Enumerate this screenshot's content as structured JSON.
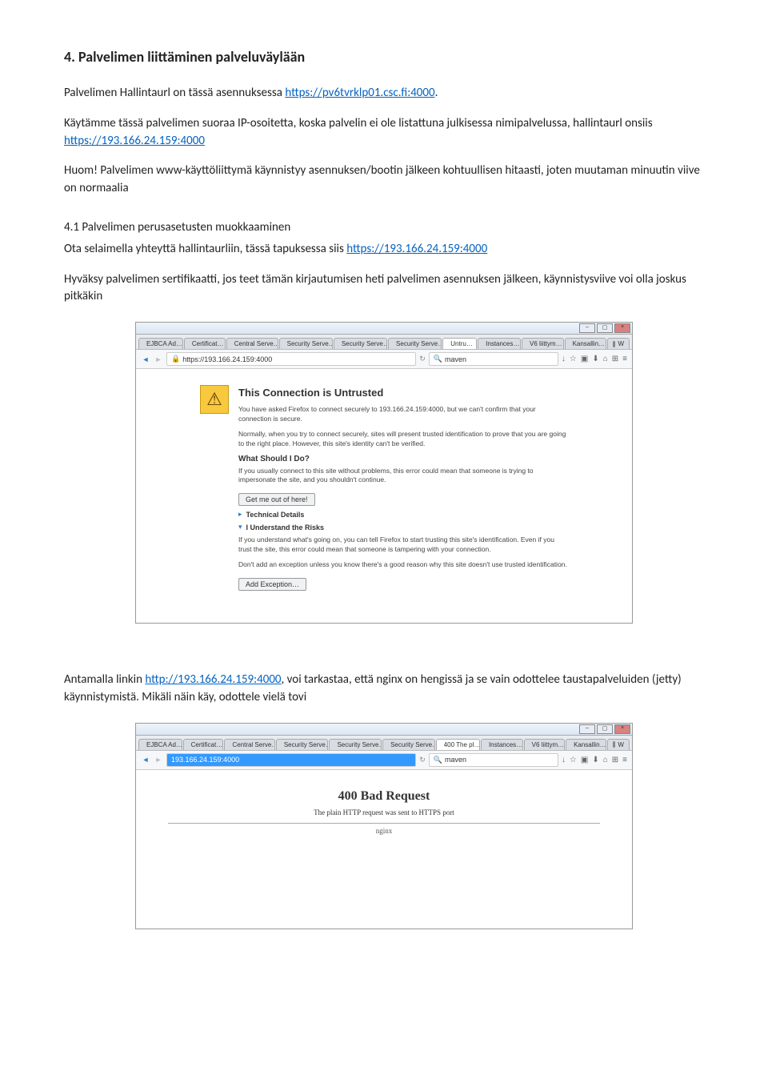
{
  "heading": "4.   Palvelimen liittäminen palveluväylään",
  "para1_a": "Palvelimen Hallintaurl on tässä asennuksessa ",
  "para1_link": "https://pv6tvrklp01.csc.fi:4000",
  "para1_b": ".",
  "para2_a": "Käytämme tässä palvelimen suoraa IP-osoitetta, koska palvelin ei ole listattuna julkisessa nimipalvelussa, hallintaurl onsiis ",
  "para2_link": "https://193.166.24.159:4000",
  "para3": "Huom! Palvelimen www-käyttöliittymä käynnistyy asennuksen/bootin jälkeen kohtuullisen hitaasti, joten muutaman minuutin viive on normaalia",
  "sub1": "4.1 Palvelimen perusasetusten muokkaaminen",
  "para4_a": "Ota selaimella yhteyttä hallintaurliin, tässä tapuksessa siis ",
  "para4_link": "https://193.166.24.159:4000",
  "para5": "Hyväksy palvelimen sertifikaatti, jos teet tämän kirjautumisen heti palvelimen asennuksen jälkeen, käynnistysviive voi olla joskus pitkäkin",
  "para6_a": "Antamalla linkin ",
  "para6_link": "http://193.166.24.159:4000",
  "para6_b": ", voi tarkastaa, että nginx on hengissä ja se vain odottelee taustapalveluiden (jetty) käynnistymistä. Mikäli näin käy, odottele vielä tovi",
  "browser1": {
    "tabs": [
      "EJBCA Ad…",
      "Certificat…",
      "Central Serve…",
      "Security Serve…",
      "Security Serve…",
      "Security Serve…",
      "Untru…",
      "Instances…",
      "V6 liittym…",
      "Kansallin…",
      "W"
    ],
    "url": "https://193.166.24.159:4000",
    "search": "maven",
    "title": "This Connection is Untrusted",
    "t1": "You have asked Firefox to connect securely to 193.166.24.159:4000, but we can't confirm that your connection is secure.",
    "t2": "Normally, when you try to connect securely, sites will present trusted identification to prove that you are going to the right place. However, this site's identity can't be verified.",
    "h2": "What Should I Do?",
    "t3": "If you usually connect to this site without problems, this error could mean that someone is trying to impersonate the site, and you shouldn't continue.",
    "btn1": "Get me out of here!",
    "tech": "Technical Details",
    "risks": "I Understand the Risks",
    "t4": "If you understand what's going on, you can tell Firefox to start trusting this site's identification. Even if you trust the site, this error could mean that someone is tampering with your connection.",
    "t5": "Don't add an exception unless you know there's a good reason why this site doesn't use trusted identification.",
    "btn2": "Add Exception…"
  },
  "browser2": {
    "tabs": [
      "EJBCA Ad…",
      "Certificat…",
      "Central Serve…",
      "Security Serve…",
      "Security Serve…",
      "Security Serve…",
      "400 The pl…",
      "Instances…",
      "V6 liittym…",
      "Kansallin…",
      "W"
    ],
    "url": "193.166.24.159:4000",
    "search": "maven",
    "title": "400 Bad Request",
    "msg": "The plain HTTP request was sent to HTTPS port",
    "srv": "nginx"
  }
}
